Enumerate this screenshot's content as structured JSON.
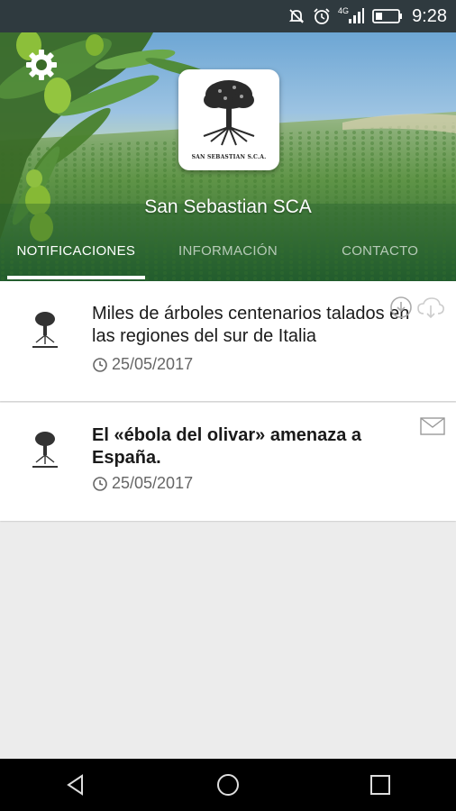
{
  "status_bar": {
    "time": "9:28",
    "network_label": "4G",
    "icons": [
      "mute-icon",
      "alarm-icon",
      "signal-icon",
      "battery-icon"
    ]
  },
  "header": {
    "company_name": "San Sebastian SCA",
    "logo_caption": "SAN SEBASTIAN S.C.A.",
    "settings_icon": "gear-icon"
  },
  "tabs": [
    {
      "label": "NOTIFICACIONES",
      "active": true
    },
    {
      "label": "INFORMACIÓN",
      "active": false
    },
    {
      "label": "CONTACTO",
      "active": false
    }
  ],
  "notifications": [
    {
      "title": "Miles de árboles centenarios talados en las regiones del sur de Italia",
      "date": "25/05/2017",
      "read": true,
      "icons": [
        "download-circle-icon",
        "cloud-download-icon"
      ]
    },
    {
      "title": "El «ébola del olivar» amenaza a España.",
      "date": "25/05/2017",
      "read": false,
      "icons": [
        "envelope-icon"
      ]
    }
  ],
  "nav_bar": {
    "icons": [
      "back-icon",
      "home-icon",
      "recents-icon"
    ]
  },
  "colors": {
    "status_bar": "#2f3a3f",
    "header_green": "#2a6a35",
    "sky": "#6da6d4",
    "background": "#ececec"
  }
}
